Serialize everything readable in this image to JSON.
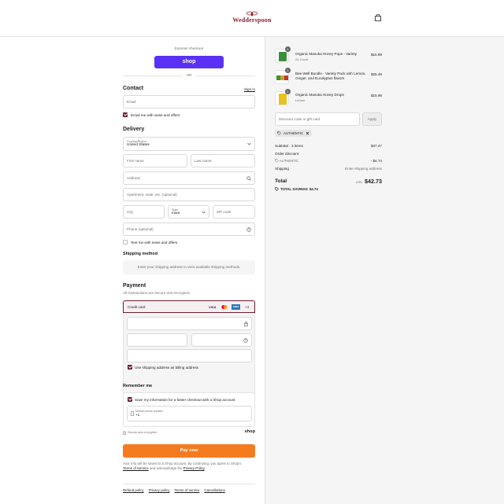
{
  "brand": {
    "name": "Wedderspoon",
    "color": "#8b2332"
  },
  "header": {
    "cart_icon": "bag-icon"
  },
  "express": {
    "label": "Express checkout",
    "shop_label": "shop",
    "or_label": "OR"
  },
  "contact": {
    "title": "Contact",
    "sign_in": "Sign in",
    "email_placeholder": "Email",
    "email_optin": "Email me with news and offers"
  },
  "delivery": {
    "title": "Delivery",
    "country_label": "Country/Region",
    "country_value": "United States",
    "first_name": "First name",
    "last_name": "Last name",
    "address": "Address",
    "apartment": "Apartment, suite, etc. (optional)",
    "city": "City",
    "state_label": "State",
    "state_value": "Iowa",
    "zip": "ZIP code",
    "phone": "Phone (optional)",
    "text_optin": "Text me with news and offers"
  },
  "shipping": {
    "title": "Shipping method",
    "notice": "Enter your shipping address to view available shipping methods."
  },
  "payment": {
    "title": "Payment",
    "subtitle": "All transactions are secure and encrypted.",
    "method": "Credit card",
    "card_brands": [
      "VISA",
      "MC",
      "AMEX"
    ],
    "more_brands": "+4",
    "billing_same": "Use shipping address as billing address"
  },
  "remember": {
    "title": "Remember me",
    "save_info": "Save my information for a faster checkout with a Shop account",
    "mobile_label": "Mobile phone number",
    "mobile_prefix": "+1",
    "secure": "Secure and encrypted",
    "shop_logo": "shop"
  },
  "pay_button": "Pay now",
  "legal": {
    "line1": "Your info will be saved to a Shop account. By continuing, you agree to Shop's",
    "terms": "Terms of Service",
    "and": "and acknowledge the",
    "privacy": "Privacy Policy",
    "end": "."
  },
  "footer_links": [
    "Refund policy",
    "Privacy policy",
    "Terms of service",
    "Cancellations"
  ],
  "cart": {
    "items": [
      {
        "name": "Organic Manuka Honey Pops - Variety",
        "variant": "24 Count",
        "price": "$15.99",
        "qty": "1",
        "color": "#3a8f3a"
      },
      {
        "name": "Bee Well Bundle - Variety Pack with Lemon, Ginger, and Eucalyptus flavors",
        "variant": "",
        "price": "$25.49",
        "qty": "1",
        "color": "#c9a227"
      },
      {
        "name": "Organic Manuka Honey Drops",
        "variant": "Lemon",
        "price": "$15.99",
        "qty": "1",
        "color": "#e8c21e"
      }
    ],
    "discount_placeholder": "Discount code or gift card",
    "apply": "Apply",
    "applied_code": "AUTHENTIC",
    "subtotal_label": "Subtotal · 3 items",
    "subtotal_value": "$47.47",
    "order_discount_label": "Order discount",
    "discount_code": "AUTHENTIC",
    "discount_value": "- $4.74",
    "shipping_label": "Shipping",
    "shipping_value": "Enter shipping address",
    "total_label": "Total",
    "currency": "USD",
    "total_value": "$42.73",
    "savings_label": "TOTAL SAVINGS",
    "savings_value": "$4.74"
  }
}
